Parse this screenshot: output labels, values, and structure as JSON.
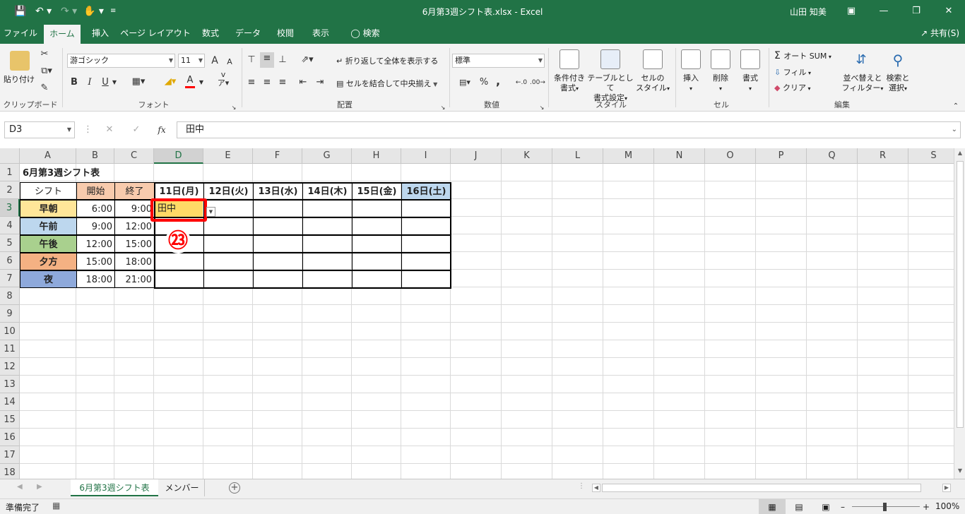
{
  "titlebar": {
    "title": "6月第3週シフト表.xlsx  -  Excel",
    "user": "山田 知美"
  },
  "menu": {
    "items": [
      "ファイル",
      "ホーム",
      "挿入",
      "ページ レイアウト",
      "数式",
      "データ",
      "校閲",
      "表示"
    ],
    "search": "検索",
    "share": "共有(S)"
  },
  "ribbon": {
    "clipboard": {
      "paste": "貼り付け",
      "label": "クリップボード"
    },
    "font": {
      "name": "游ゴシック",
      "size": "11",
      "label": "フォント",
      "bold": "B",
      "italic": "I",
      "underline": "U",
      "grow": "A",
      "shrink": "A",
      "fontcolor": "A"
    },
    "align": {
      "wrap": "折り返して全体を表示する",
      "merge": "セルを結合して中央揃え",
      "label": "配置"
    },
    "number": {
      "format": "標準",
      "label": "数値",
      "percent": "%",
      "comma": ","
    },
    "styles": {
      "cond1": "条件付き",
      "cond2": "書式",
      "table1": "テーブルとして",
      "table2": "書式設定",
      "cell1": "セルの",
      "cell2": "スタイル",
      "label": "スタイル"
    },
    "cells": {
      "insert": "挿入",
      "delete": "削除",
      "format": "書式",
      "label": "セル"
    },
    "editing": {
      "autosum": "オート SUM",
      "fill": "フィル",
      "clear": "クリア",
      "sort1": "並べ替えと",
      "sort2": "フィルター",
      "find1": "検索と",
      "find2": "選択",
      "label": "編集"
    }
  },
  "formula": {
    "namebox": "D3",
    "fx": "fx",
    "content": "田中"
  },
  "columns": [
    "A",
    "B",
    "C",
    "D",
    "E",
    "F",
    "G",
    "H",
    "I",
    "J",
    "K",
    "L",
    "M",
    "N",
    "O",
    "P",
    "Q",
    "R",
    "S"
  ],
  "rows": [
    "1",
    "2",
    "3",
    "4",
    "5",
    "6",
    "7",
    "8",
    "9",
    "10",
    "11",
    "12",
    "13",
    "14",
    "15",
    "16",
    "17",
    "18"
  ],
  "sheet": {
    "title": "6月第3週シフト表",
    "header": {
      "shift": "シフト",
      "start": "開始",
      "end": "終了",
      "days": [
        "11日(月)",
        "12日(火)",
        "13日(水)",
        "14日(木)",
        "15日(金)",
        "16日(土)"
      ]
    },
    "shifts": [
      {
        "name": "早朝",
        "start": "6:00",
        "end": "9:00",
        "color": "#ffe699"
      },
      {
        "name": "午前",
        "start": "9:00",
        "end": "12:00",
        "color": "#bdd7ee"
      },
      {
        "name": "午後",
        "start": "12:00",
        "end": "15:00",
        "color": "#a9d08e"
      },
      {
        "name": "夕方",
        "start": "15:00",
        "end": "18:00",
        "color": "#f4b183"
      },
      {
        "name": "夜",
        "start": "18:00",
        "end": "21:00",
        "color": "#8ea9db"
      }
    ],
    "d3": "田中",
    "step": "㉓"
  },
  "tabs": {
    "active": "6月第3週シフト表",
    "other": "メンバー"
  },
  "status": {
    "ready": "準備完了",
    "zoom": "100%"
  },
  "colors": {
    "accent": "#217346",
    "highlight": "#ff0000",
    "start_header": "#f8cbad",
    "sat_header": "#bdd7ee"
  }
}
